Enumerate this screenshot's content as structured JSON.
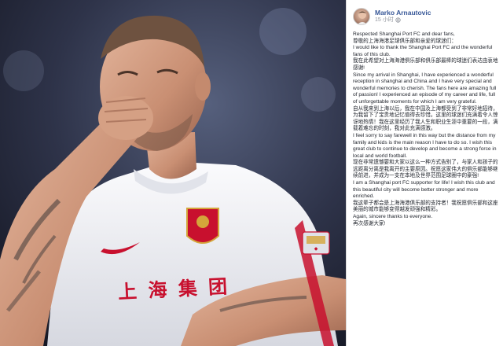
{
  "post": {
    "author": "Marko Arnautovic",
    "time": "15 小时",
    "paragraphs": [
      "Respected Shanghai Port FC and dear fans,",
      "尊敬的上海海港足球俱乐部和亲爱的球迷们：",
      "I would like to thank the Shanghai Port FC and the wonderful fans of this club.",
      "我在此希望对上海海港俱乐部和俱乐部最棒的球迷们表达由衷地感谢!",
      "Since my arrival in Shanghai, I have experienced a wonderful reception in shanghai and China and I have very special and wonderful memories to cherish. The fans here are amazing full of passion! I experienced an episode of my career and life, full of unforgettable moments for which I am very grateful.",
      "自从我来到上海以后，我在中国及上海都受到了非常好地招待，为我留下了宝贵地记忆值得去珍惜。这里的球迷们充满着令人惊讶地热情！我在这里经历了我人生和职业生涯中重要的一段，满载着难忘的时刻，我对此充满感激。",
      "I feel sorry to say farewell in this way but the distance from my family and kids is the main reason I have to do so. I wish this great club to continue to develop and become a strong force in local and world football.",
      "现在非常遗憾要和大家以这么一种方式告别了，与家人和孩子的远距离分离是我离开的主要原因。祝愿这家伟大的俱乐部能够继续前进，并成为一支在本地及世界范围足球圈中的豪强!",
      "I am a Shanghai port FC supporter for life! I wish this club and this beautiful city will become better stronger and more enriched.",
      "我这辈子都会是上海海港俱乐部的支持者！我祝愿俱乐部和这座美丽的城市能够变得越发顽强和精彩。",
      "Again, sincere thanks to everyone.",
      "再次感谢大家!"
    ]
  },
  "photo": {
    "jersey_text": "上 海 集 团"
  },
  "icons": {
    "avatar": "avatar-photo",
    "privacy": "globe-icon"
  },
  "colors": {
    "author_link": "#385898",
    "jersey_white": "#f4f4f6",
    "crest_red": "#c8102e"
  }
}
